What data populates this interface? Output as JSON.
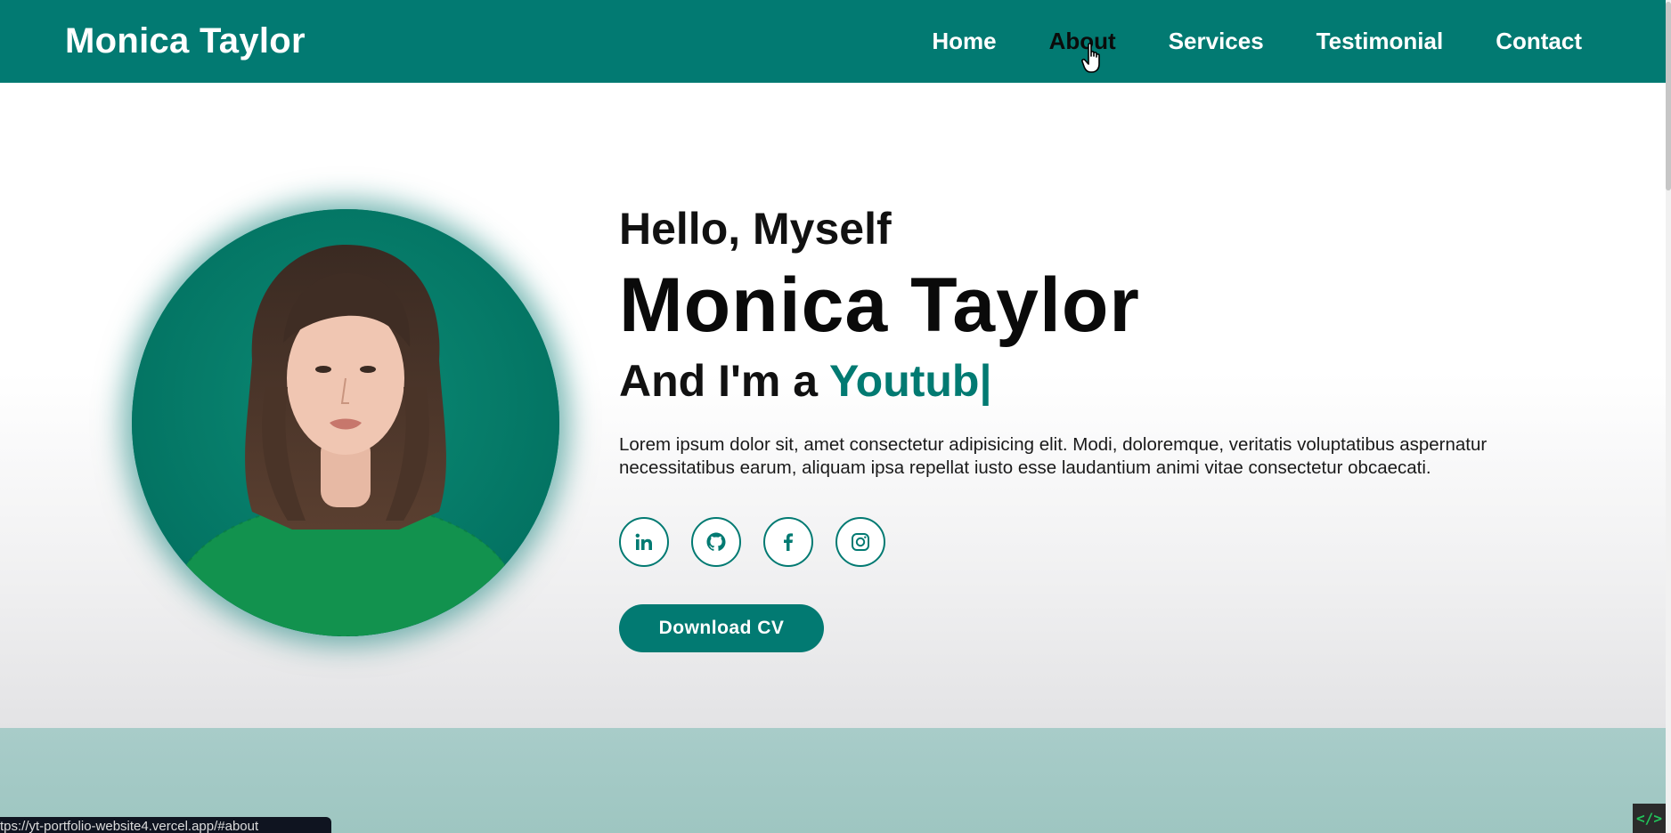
{
  "navbar": {
    "logo": "Monica Taylor",
    "links": [
      {
        "label": "Home"
      },
      {
        "label": "About"
      },
      {
        "label": "Services"
      },
      {
        "label": "Testimonial"
      },
      {
        "label": "Contact"
      }
    ],
    "active_link": "About"
  },
  "hero": {
    "greeting": "Hello, Myself",
    "name": "Monica Taylor",
    "role_prefix": "And I'm a ",
    "role_typed": "Youtub|",
    "description": "Lorem ipsum dolor sit, amet consectetur adipisicing elit. Modi, doloremque, veritatis voluptatibus aspernatur necessitatibus earum, aliquam ipsa repellat iusto esse laudantium animi vitae consectetur obcaecati.",
    "socials": [
      {
        "icon": "linkedin-icon"
      },
      {
        "icon": "github-icon"
      },
      {
        "icon": "facebook-icon"
      },
      {
        "icon": "instagram-icon"
      }
    ],
    "cv_button": "Download CV",
    "profile_image": "woman-portrait-green-sweater"
  },
  "status_bar": {
    "url": "tps://yt-portfolio-website4.vercel.app/#about"
  },
  "extension_icon": {
    "label": "</>"
  },
  "colors": {
    "brand": "#027a72",
    "active_nav": "#0b0b0b",
    "next_section": "#a8ccc9"
  }
}
